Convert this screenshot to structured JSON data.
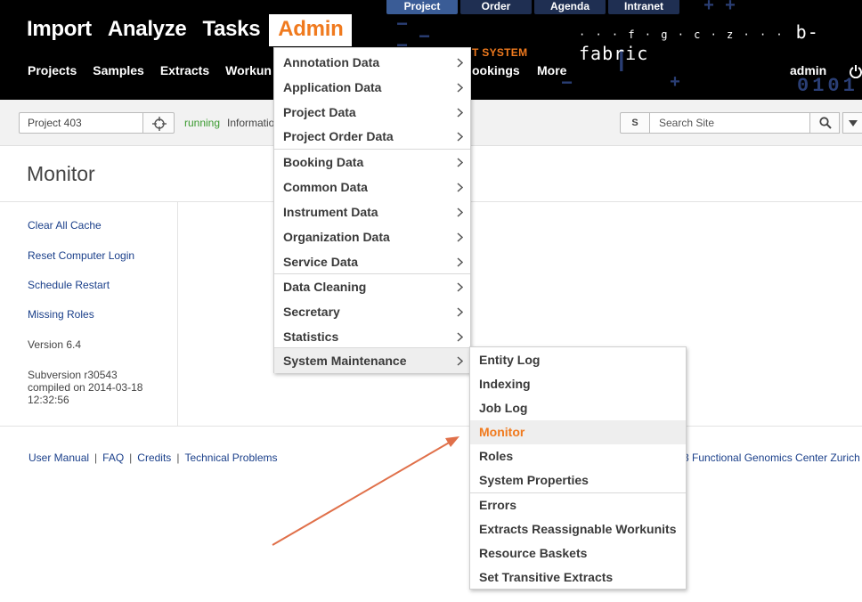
{
  "header": {
    "top_tabs": [
      "Project",
      "Order",
      "Agenda",
      "Intranet"
    ],
    "main_nav": [
      "Import",
      "Analyze",
      "Tasks",
      "Admin"
    ],
    "sub_nav": [
      "Projects",
      "Samples",
      "Extracts",
      "Workun"
    ],
    "sub_nav_right": [
      "ookings",
      "More"
    ],
    "system_label": "T SYSTEM",
    "brand_dots": "· · · f · g · c · z · · ·",
    "brand_name": "b-fabric",
    "user": "admin",
    "deco_binary": "0101",
    "colors": {
      "background": "#000000",
      "accent": "#f07a1e",
      "tab": "#1f2f52"
    }
  },
  "toolbar": {
    "project_value": "Project 403",
    "status_running": "running",
    "status_info": "Informatio",
    "search_scope": "S",
    "search_placeholder": "Search Site"
  },
  "page": {
    "title": "Monitor",
    "side_links": [
      "Clear All Cache",
      "Reset Computer Login",
      "Schedule Restart",
      "Missing Roles"
    ],
    "version": "Version 6.4",
    "build_line1": "Subversion r30543",
    "build_line2": "compiled on 2014-03-18",
    "build_line3": "12:32:56"
  },
  "footer": {
    "links": [
      "User Manual",
      "FAQ",
      "Credits",
      "Technical Problems"
    ],
    "copyright": "3 Functional Genomics Center Zurich"
  },
  "admin_menu": {
    "items": [
      "Annotation Data",
      "Application Data",
      "Project Data",
      "Project Order Data",
      "Booking Data",
      "Common Data",
      "Instrument Data",
      "Organization Data",
      "Service Data",
      "Data Cleaning",
      "Secretary",
      "Statistics",
      "System Maintenance"
    ],
    "highlighted": "System Maintenance"
  },
  "system_maintenance_menu": {
    "items": [
      "Entity Log",
      "Indexing",
      "Job Log",
      "Monitor",
      "Roles",
      "System Properties",
      "Errors",
      "Extracts Reassignable Workunits",
      "Resource Baskets",
      "Set Transitive Extracts"
    ],
    "active": "Monitor"
  },
  "annotation": {
    "arrow_color": "#e0704a",
    "points_to": "Monitor"
  }
}
